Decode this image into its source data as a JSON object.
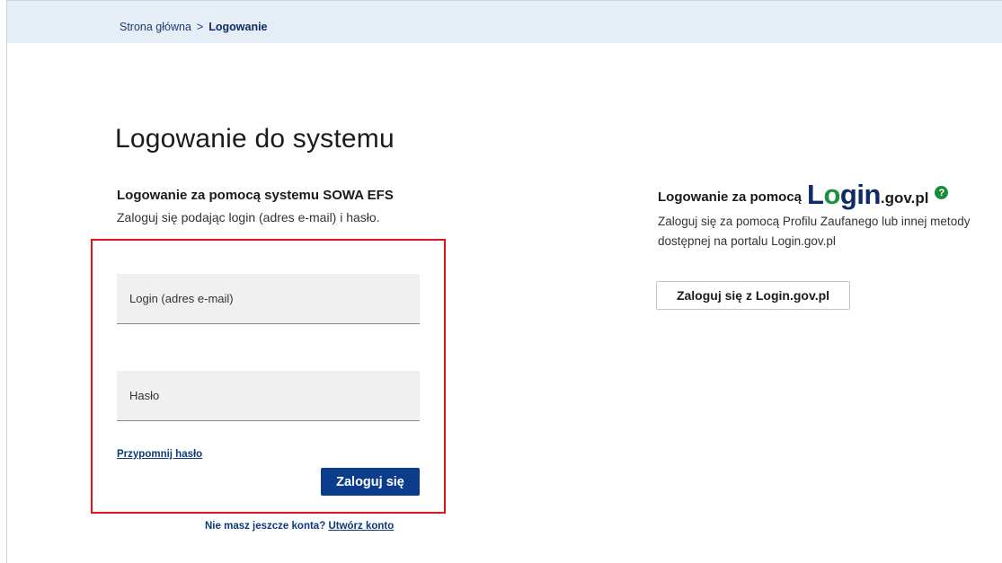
{
  "breadcrumb": {
    "home": "Strona główna",
    "separator": ">",
    "current": "Logowanie"
  },
  "page_title": "Logowanie do systemu",
  "sowa_login": {
    "heading": "Logowanie za pomocą systemu SOWA EFS",
    "subtitle": "Zaloguj się podając login (adres e-mail) i hasło.",
    "login_placeholder": "Login (adres e-mail)",
    "password_placeholder": "Hasło",
    "remind_password": "Przypomnij hasło",
    "submit_label": "Zaloguj się",
    "no_account_text": "Nie masz jeszcze konta?",
    "create_account_link": "Utwórz konto"
  },
  "gov_login": {
    "heading": "Logowanie za pomocą",
    "logo_main_pre": "L",
    "logo_main_o": "o",
    "logo_main_post": "gin",
    "logo_suffix": ".gov.pl",
    "help_icon": "question-circle-icon",
    "help_symbol": "?",
    "description": "Zaloguj się za pomocą Profilu Zaufanego lub innej metody dostępnej na portalu Login.gov.pl",
    "button_label": "Zaloguj się z Login.gov.pl"
  },
  "colors": {
    "primary": "#0b3d8c",
    "highlight_border": "#e3101d",
    "breadcrumb_bg": "#e5eef6",
    "help_icon_bg": "#198c3c"
  }
}
